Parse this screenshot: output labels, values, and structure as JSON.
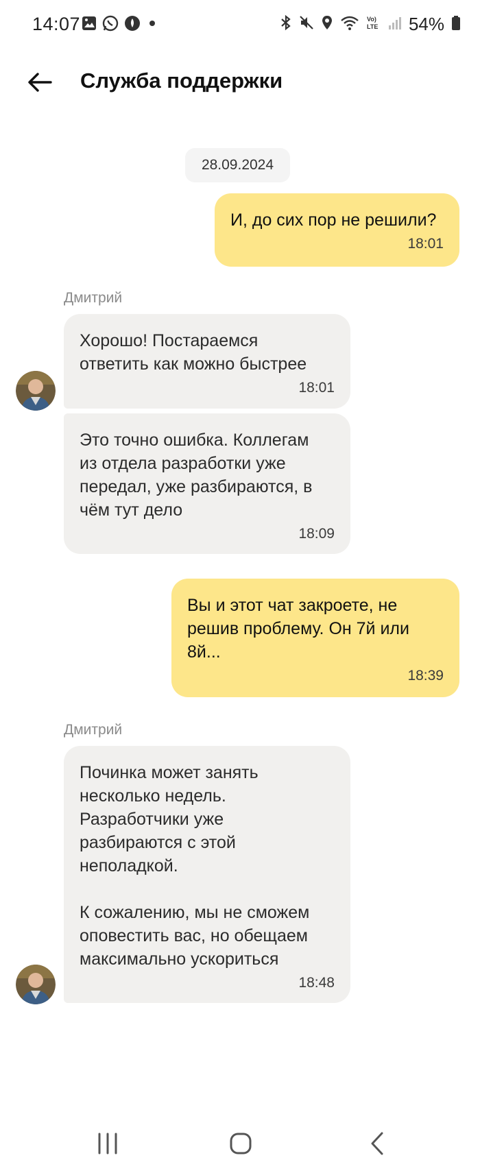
{
  "status_bar": {
    "time": "14:07",
    "battery_percent": "54%",
    "left_icons": [
      "gallery-icon",
      "whatsapp-icon",
      "app-notification-icon",
      "dot-icon"
    ],
    "right_icons": [
      "bluetooth-icon",
      "mute-icon",
      "location-icon",
      "wifi-icon",
      "volte-icon",
      "signal-icon",
      "battery-icon"
    ]
  },
  "header": {
    "title": "Служба поддержки",
    "back_icon": "arrow-left-icon"
  },
  "chat": {
    "date": "28.09.2024",
    "messages": [
      {
        "direction": "out",
        "text": "И, до сих пор не решили?",
        "time": "18:01"
      },
      {
        "direction": "in",
        "sender": "Дмитрий",
        "text": "Хорошо! Постараемся\nответить как можно быстрее",
        "time": "18:01"
      },
      {
        "direction": "in",
        "text": "Это точно ошибка. Коллегам\nиз отдела разработки уже\nпередал, уже разбираются, в\nчём тут дело",
        "time": "18:09"
      },
      {
        "direction": "out",
        "text": "Вы и этот чат закроете, не\nрешив проблему. Он 7й или\n8й...",
        "time": "18:39"
      },
      {
        "direction": "in",
        "sender": "Дмитрий",
        "text": "Починка может занять\nнесколько недель.\nРазработчики уже\nразбираются с этой\nнеполадкой.\n\nК сожалению, мы не сможем\nоповестить вас, но обещаем\nмаксимально ускориться",
        "time": "18:48"
      }
    ]
  },
  "colors": {
    "outgoing_bubble": "#fde68a",
    "incoming_bubble": "#f1f0ee",
    "date_chip": "#f4f4f4"
  },
  "nav_bar": {
    "icons": [
      "recent-apps-icon",
      "home-icon",
      "back-icon"
    ]
  }
}
